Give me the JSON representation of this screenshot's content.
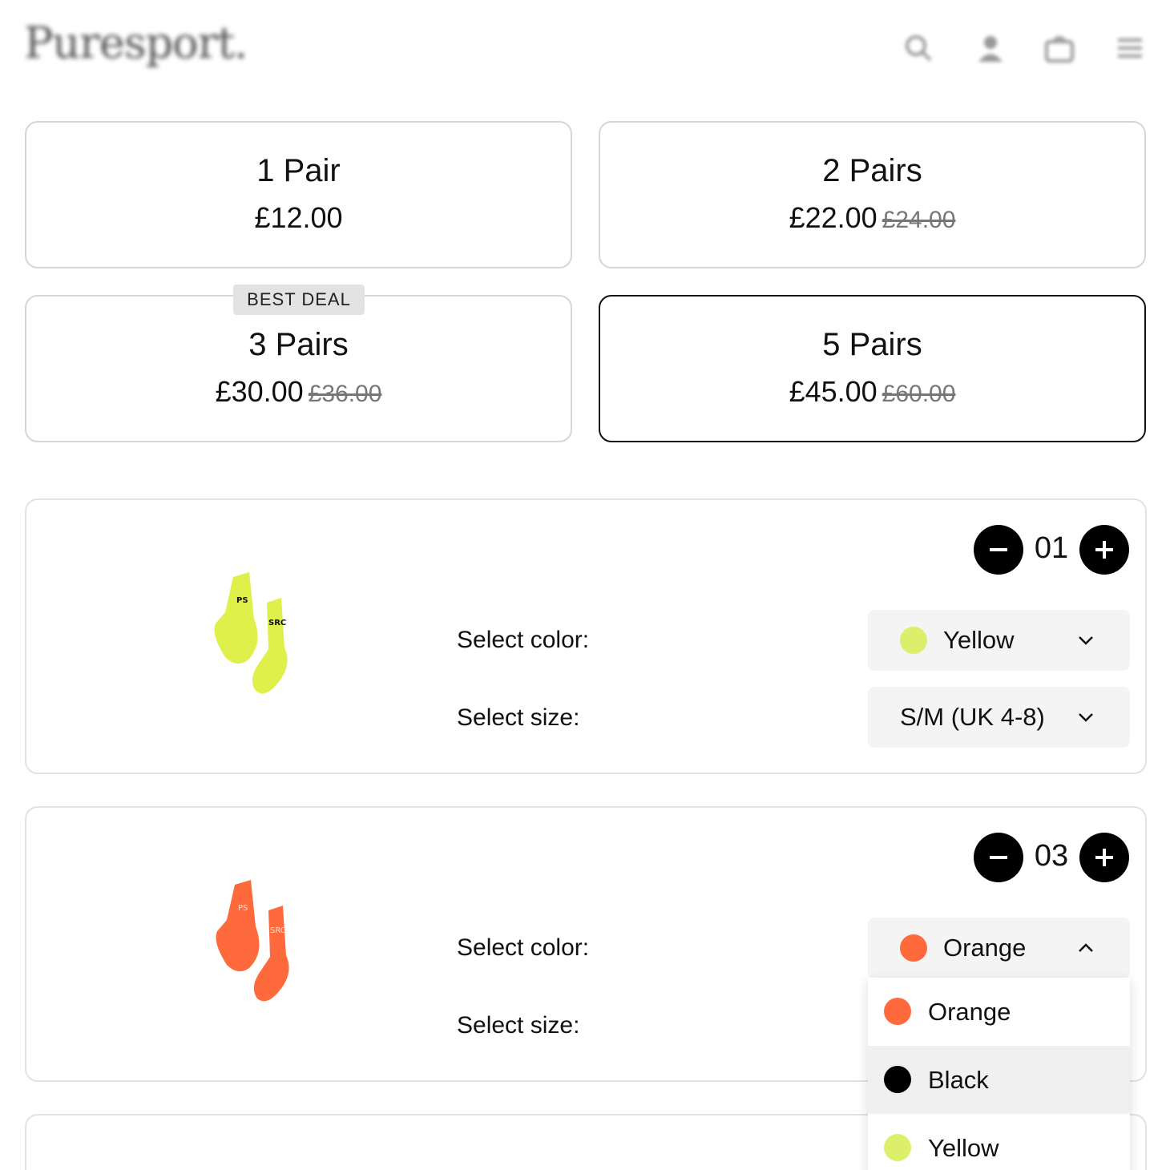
{
  "header": {
    "logo": "Puresport.",
    "icons": [
      "search-icon",
      "account-icon",
      "cart-icon",
      "menu-icon"
    ]
  },
  "bundles": [
    {
      "qty": "1 Pair",
      "price": "£12.00",
      "old_price": "",
      "badge": "",
      "selected": false
    },
    {
      "qty": "2 Pairs",
      "price": "£22.00",
      "old_price": "£24.00",
      "badge": "",
      "selected": false
    },
    {
      "qty": "3 Pairs",
      "price": "£30.00",
      "old_price": "£36.00",
      "badge": "BEST DEAL",
      "selected": false
    },
    {
      "qty": "5 Pairs",
      "price": "£45.00",
      "old_price": "£60.00",
      "badge": "",
      "selected": true
    }
  ],
  "products": [
    {
      "quantity": "01",
      "color_label": "Select color:",
      "size_label": "Select size:",
      "color_value": "Yellow",
      "color_hex": "#dcef6b",
      "size_value": "S/M (UK 4-8)",
      "dropdown_open": false
    },
    {
      "quantity": "03",
      "color_label": "Select color:",
      "size_label": "Select size:",
      "color_value": "Orange",
      "color_hex": "#ff6a3d",
      "size_value": "",
      "dropdown_open": true
    }
  ],
  "color_dropdown": {
    "options": [
      {
        "label": "Orange",
        "hex": "#ff6a3d"
      },
      {
        "label": "Black",
        "hex": "#000000"
      },
      {
        "label": "Yellow",
        "hex": "#dcef6b"
      }
    ],
    "hovered": "Black"
  },
  "colors": {
    "selected_border": "#111111",
    "card_border": "#d6d6d6",
    "select_bg": "#f4f4f4"
  }
}
